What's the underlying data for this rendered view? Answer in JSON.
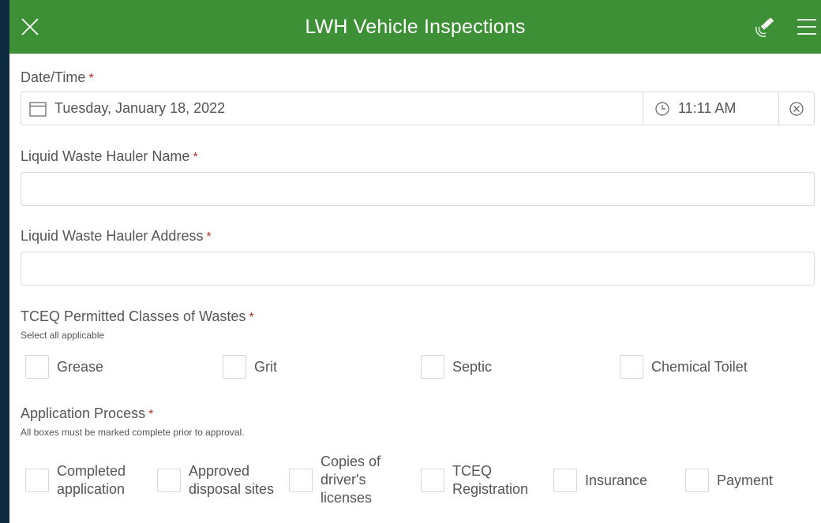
{
  "header": {
    "title": "LWH Vehicle Inspections"
  },
  "datetime": {
    "label": "Date/Time",
    "required_mark": "*",
    "date_value": "Tuesday, January 18, 2022",
    "time_value": "11:11 AM"
  },
  "hauler_name": {
    "label": "Liquid Waste Hauler Name",
    "required_mark": "*",
    "value": ""
  },
  "hauler_address": {
    "label": "Liquid Waste Hauler Address",
    "required_mark": "*",
    "value": ""
  },
  "waste_classes": {
    "label": "TCEQ Permitted Classes of Wastes",
    "required_mark": "*",
    "hint": "Select all applicable",
    "options": [
      "Grease",
      "Grit",
      "Septic",
      "Chemical Toilet"
    ]
  },
  "application": {
    "label": "Application Process",
    "required_mark": "*",
    "hint": "All boxes must be marked complete prior to approval.",
    "options": [
      {
        "line1": "Completed",
        "line2": "application",
        "line3": ""
      },
      {
        "line1": "Approved",
        "line2": "disposal sites",
        "line3": ""
      },
      {
        "line1": "Copies of",
        "line2": "driver's",
        "line3": "licenses"
      },
      {
        "line1": "TCEQ",
        "line2": "Registration",
        "line3": ""
      },
      {
        "line1": "Insurance",
        "line2": "",
        "line3": ""
      },
      {
        "line1": "Payment",
        "line2": "",
        "line3": ""
      }
    ]
  },
  "colors": {
    "header_bg": "#3e9036",
    "required": "#b3322b",
    "outer_bg": "#0d2b3e"
  },
  "icons": {
    "close": "close-icon",
    "gps": "gps-satellite-icon",
    "menu": "hamburger-menu-icon",
    "calendar": "calendar-icon",
    "clock": "clock-icon",
    "clear": "clear-circle-icon"
  }
}
